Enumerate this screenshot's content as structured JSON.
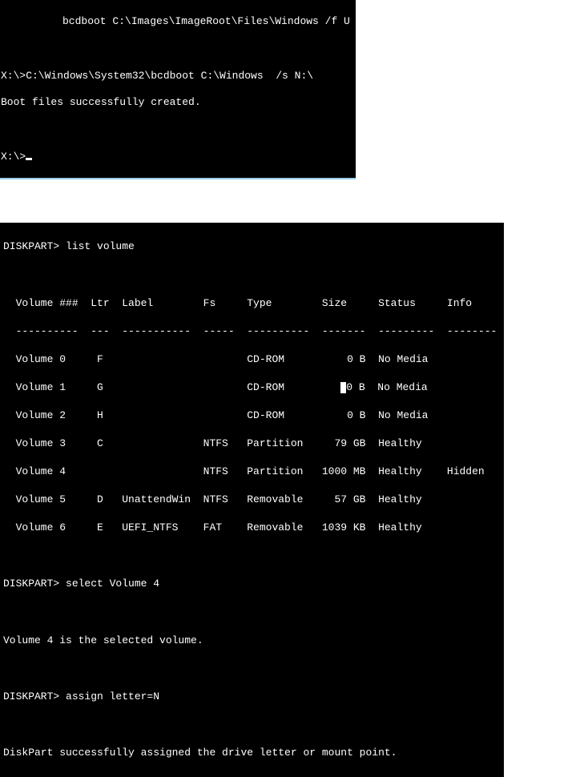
{
  "top_terminal": {
    "title_cmd": "bcdboot C:\\Images\\ImageRoot\\Files\\Windows /f U",
    "command_line": "X:\\>C:\\Windows\\System32\\bcdboot C:\\Windows  /s N:\\",
    "result_line": "Boot files successfully created.",
    "prompt": "X:\\>"
  },
  "diskpart": {
    "prompt1": "DISKPART> ",
    "cmd1": "list volume",
    "header": "  Volume ###  Ltr  Label        Fs     Type        Size     Status     Info",
    "divider": "  ----------  ---  -----------  -----  ----------  -------  ---------  --------",
    "rows": [
      "  Volume 0     F                       CD-ROM          0 B  No Media",
      "  Volume 1     G                       CD-ROM          0 B  No Media",
      "  Volume 2     H                       CD-ROM          0 B  No Media",
      "  Volume 3     C                NTFS   Partition     79 GB  Healthy",
      "  Volume 4                      NTFS   Partition   1000 MB  Healthy    Hidden",
      "  Volume 5     D   UnattendWin  NTFS   Removable     57 GB  Healthy",
      "  Volume 6     E   UEFI_NTFS    FAT    Removable   1039 KB  Healthy"
    ],
    "prompt2": "DISKPART> ",
    "cmd2": "select Volume 4",
    "result2": "Volume 4 is the selected volume.",
    "prompt3": "DISKPART> ",
    "cmd3": "assign letter=N",
    "result3": "DiskPart successfully assigned the drive letter or mount point."
  }
}
